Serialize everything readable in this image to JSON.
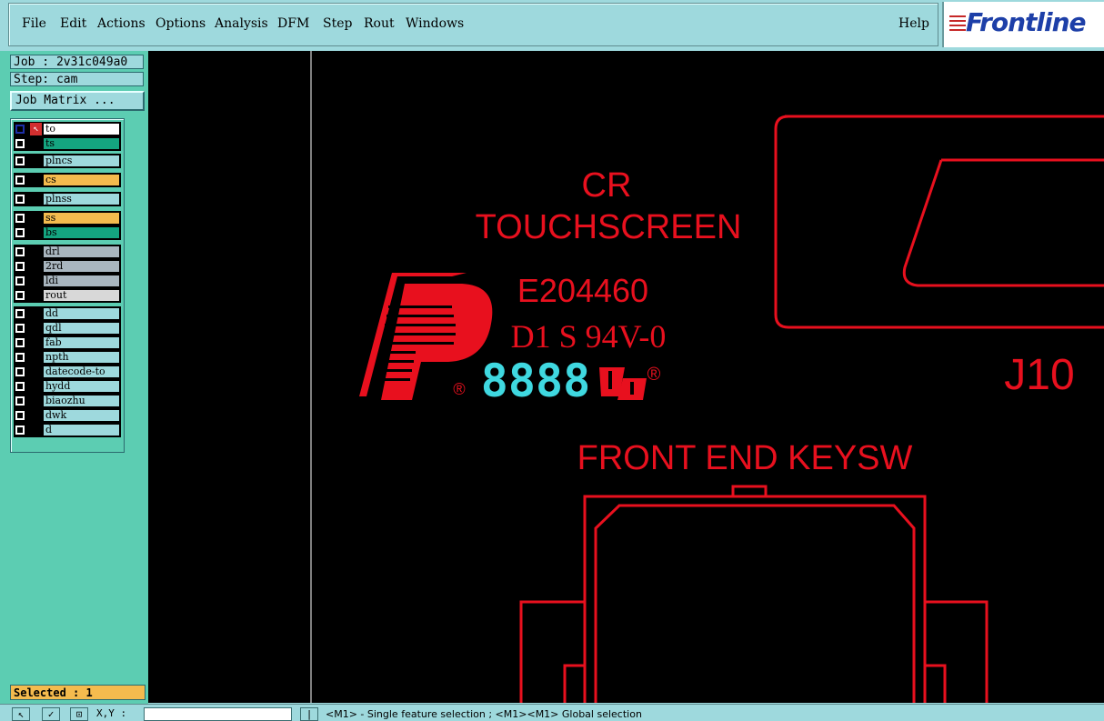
{
  "menu": {
    "items": [
      {
        "label": "File"
      },
      {
        "label": "Edit"
      },
      {
        "label": "Actions"
      },
      {
        "label": "Options"
      },
      {
        "label": "Analysis"
      },
      {
        "label": "DFM"
      },
      {
        "label": "Step"
      },
      {
        "label": "Rout"
      },
      {
        "label": "Windows"
      }
    ],
    "help": "Help"
  },
  "brand": {
    "logo": "Frontline",
    "logo_color": "#1d3fa8",
    "stripe_color": "#c62828"
  },
  "job": {
    "label": "Job : 2v31c049a0",
    "step": "Step: cam",
    "matrix_button": "Job Matrix ..."
  },
  "layers": [
    {
      "name": "to",
      "color": "#ffffff"
    },
    {
      "name": "ts",
      "color": "#14a580"
    },
    {
      "name": "plncs",
      "color": "#9ed9dd"
    },
    {
      "name": "cs",
      "color": "#f4bb4e"
    },
    {
      "name": "plnss",
      "color": "#9ed9dd"
    },
    {
      "name": "ss",
      "color": "#f4bb4e"
    },
    {
      "name": "bs",
      "color": "#14a580"
    },
    {
      "name": "drl",
      "color": "#a9b6bf"
    },
    {
      "name": "2rd",
      "color": "#a9b6bf"
    },
    {
      "name": "ldi",
      "color": "#a9b6bf"
    },
    {
      "name": "rout",
      "color": "#d8d8d8"
    },
    {
      "name": "dd",
      "color": "#9ed9dd"
    },
    {
      "name": "qdl",
      "color": "#9ed9dd"
    },
    {
      "name": "fab",
      "color": "#9ed9dd"
    },
    {
      "name": "npth",
      "color": "#9ed9dd"
    },
    {
      "name": "datecode-to",
      "color": "#9ed9dd"
    },
    {
      "name": "hydd",
      "color": "#9ed9dd"
    },
    {
      "name": "biaozhu",
      "color": "#9ed9dd"
    },
    {
      "name": "dwk",
      "color": "#9ed9dd"
    },
    {
      "name": "d",
      "color": "#9ed9dd"
    }
  ],
  "status": {
    "selected": "Selected : 1"
  },
  "canvas": {
    "texts": {
      "cr": "CR",
      "touchscreen": "TOUCHSCREEN",
      "e_number": "E204460",
      "rating": "D1 S 94V-0",
      "datecode": "8888",
      "ref": "J10",
      "keysw": "FRONT END KEYSW",
      "reg1": "®",
      "reg2": "®"
    },
    "feature_color": "#e8101e",
    "highlight_color": "#3fd8e0"
  },
  "bottom": {
    "xy_label": "X,Y :",
    "message": "<M1> - Single feature selection ; <M1><M1> Global selection"
  }
}
